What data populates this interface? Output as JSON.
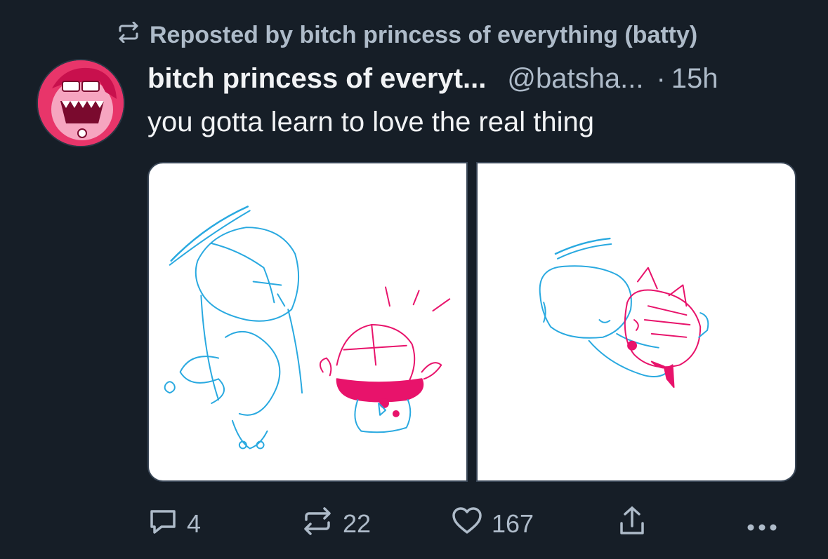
{
  "repost": {
    "label": "Reposted by bitch princess of everything (batty)",
    "icon": "repost-icon"
  },
  "post": {
    "display_name": "bitch princess of everyt...",
    "handle": "@batsha...",
    "separator": "·",
    "time": "15h",
    "text": "you gotta learn to love the real thing",
    "avatar_icon": "avatar-image",
    "images": [
      {
        "name": "drawing-left",
        "description_icon": "sketch-image"
      },
      {
        "name": "drawing-right",
        "description_icon": "sketch-image"
      }
    ]
  },
  "actions": {
    "reply_count": "4",
    "repost_count": "22",
    "like_count": "167",
    "icons": [
      "reply-icon",
      "repost-icon",
      "heart-icon",
      "share-icon",
      "more-icon"
    ]
  },
  "colors": {
    "background": "#161e27",
    "muted_text": "#aebbc9",
    "primary_text": "#f1f3f5",
    "sketch_blue": "#29a9e0",
    "sketch_pink": "#e8136b"
  }
}
